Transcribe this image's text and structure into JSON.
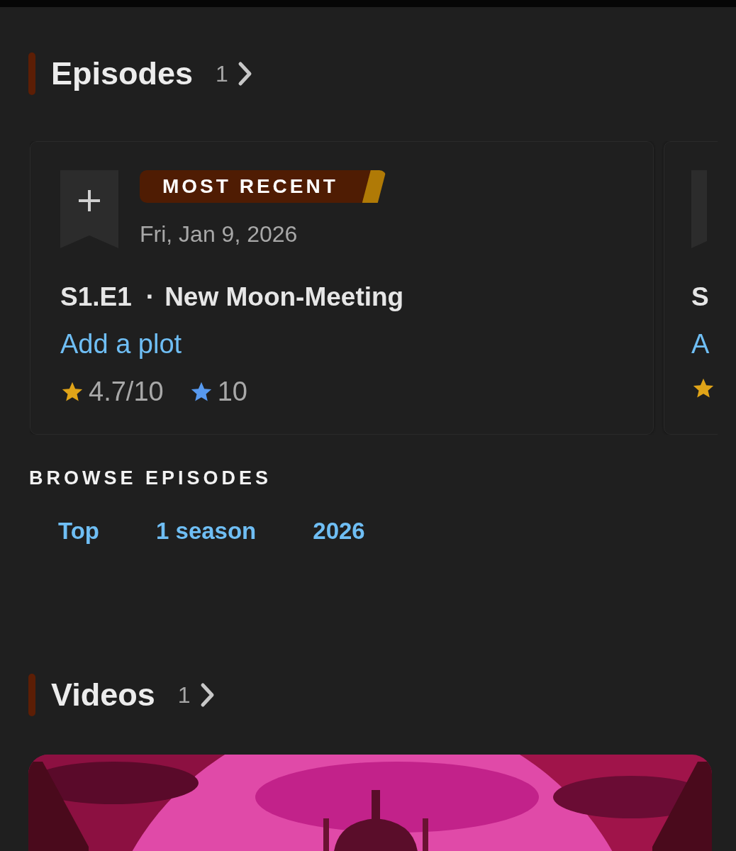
{
  "episodes": {
    "title": "Episodes",
    "count": "1",
    "cards": [
      {
        "kind": "full",
        "badge": "MOST RECENT",
        "date": "Fri, Jan 9, 2026",
        "code": "S1.E1",
        "separator": "·",
        "name": "New Moon-Meeting",
        "plot_link": "Add a plot",
        "rating": "4.7/10",
        "user_rating": "10"
      },
      {
        "kind": "cut",
        "code": "S",
        "plot_link": "A"
      }
    ]
  },
  "browse": {
    "title": "BROWSE EPISODES",
    "links": [
      "Top",
      "1 season",
      "2026"
    ]
  },
  "videos": {
    "title": "Videos",
    "count": "1"
  }
}
